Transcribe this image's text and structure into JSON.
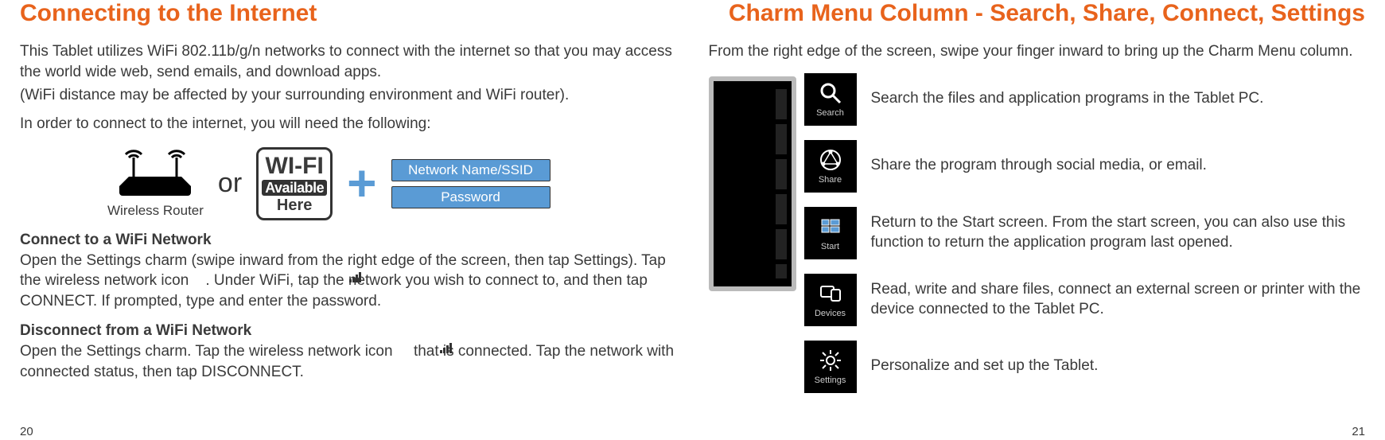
{
  "left": {
    "title": "Connecting to the Internet",
    "intro1": "This Tablet utilizes WiFi 802.11b/g/n networks to connect with the internet so that you may access the world wide web, send emails, and download apps.",
    "intro2": "(WiFi distance may be affected by your surrounding environment and WiFi router).",
    "intro3": "In order to connect to the internet, you will need the following:",
    "diagram": {
      "router_label": "Wireless Router",
      "or": "or",
      "wifi_top": "WI-FI",
      "wifi_mid": "Available",
      "wifi_bot": "Here",
      "plus": "+",
      "ssid_label": "Network Name/SSID",
      "pwd_label": "Password"
    },
    "connect_h": "Connect to a WiFi Network",
    "connect_p": "Open the Settings charm (swipe inward from the right edge of the screen, then tap Settings). Tap the wireless network icon    . Under WiFi, tap the network you wish to connect to, and then tap CONNECT. If prompted, type and enter the password.",
    "disconnect_h": "Disconnect from a WiFi Network",
    "disconnect_p": "Open the Settings charm. Tap the wireless network icon     that is connected. Tap the network with connected status, then tap DISCONNECT.",
    "page": "20"
  },
  "right": {
    "title": "Charm Menu Column - Search, Share, Connect, Settings",
    "intro": "From the right edge of the screen, swipe your finger inward to bring up the Charm Menu column.",
    "items": [
      {
        "tile": "Search",
        "desc": "Search the files and application programs in the Tablet PC."
      },
      {
        "tile": "Share",
        "desc": "Share the program through social media, or email."
      },
      {
        "tile": "Start",
        "desc": "Return to the Start screen. From the start screen, you can also use this function to return the application program last opened."
      },
      {
        "tile": "Devices",
        "desc": "Read, write and share files, connect an external screen or printer with the device connected to the Tablet PC."
      },
      {
        "tile": "Settings",
        "desc": "Personalize and set up the Tablet."
      }
    ],
    "page": "21"
  }
}
